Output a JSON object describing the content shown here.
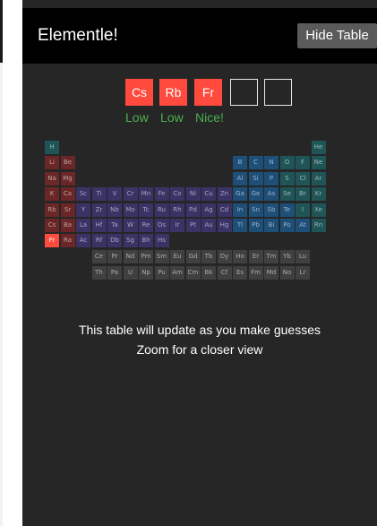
{
  "app": {
    "title": "Elementle!",
    "hide_table_label": "Hide Table"
  },
  "guesses": [
    {
      "symbol": "Cs",
      "feedback": "Low"
    },
    {
      "symbol": "Rb",
      "feedback": "Low"
    },
    {
      "symbol": "Fr",
      "feedback": "Nice!"
    },
    {
      "symbol": "",
      "feedback": ""
    },
    {
      "symbol": "",
      "feedback": ""
    }
  ],
  "message": {
    "line1": "This table will update as you make guesses",
    "line2": "Zoom for a closer view"
  },
  "colors": {
    "background": "#262626",
    "topbar": "#000000",
    "guess_fill": "#ff4a3d",
    "feedback": "#4caf50",
    "metals_alkali": "#6b2727",
    "transition": "#3b3266",
    "p_block": "#1e4f79",
    "teal": "#1f5557",
    "lanthanide": "#404040",
    "highlight": "#ff4a3d"
  },
  "table": {
    "rows": [
      [
        "H",
        "",
        "",
        "",
        "",
        "",
        "",
        "",
        "",
        "",
        "",
        "",
        "",
        "",
        "",
        "",
        "",
        "He"
      ],
      [
        "Li",
        "Be",
        "",
        "",
        "",
        "",
        "",
        "",
        "",
        "",
        "",
        "",
        "B",
        "C",
        "N",
        "O",
        "F",
        "Ne"
      ],
      [
        "Na",
        "Mg",
        "",
        "",
        "",
        "",
        "",
        "",
        "",
        "",
        "",
        "",
        "Al",
        "Si",
        "P",
        "S",
        "Cl",
        "Ar"
      ],
      [
        "K",
        "Ca",
        "Sc",
        "Ti",
        "V",
        "Cr",
        "Mn",
        "Fe",
        "Co",
        "Ni",
        "Cu",
        "Zn",
        "Ga",
        "Ge",
        "As",
        "Se",
        "Br",
        "Kr"
      ],
      [
        "Rb",
        "Sr",
        "Y",
        "Zr",
        "Nb",
        "Mo",
        "Tc",
        "Ru",
        "Rh",
        "Pd",
        "Ag",
        "Cd",
        "In",
        "Sn",
        "Sb",
        "Te",
        "I",
        "Xe"
      ],
      [
        "Cs",
        "Ba",
        "La",
        "Hf",
        "Ta",
        "W",
        "Re",
        "Os",
        "Ir",
        "Pt",
        "Au",
        "Hg",
        "Tl",
        "Pb",
        "Bi",
        "Po",
        "At",
        "Rn"
      ],
      [
        "Fr",
        "Ra",
        "Ac",
        "Rf",
        "Db",
        "Sg",
        "Bh",
        "Hs",
        "",
        "",
        "",
        "",
        "",
        "",
        "",
        "",
        "",
        ""
      ]
    ],
    "lanthanides": [
      "Ce",
      "Pr",
      "Nd",
      "Pm",
      "Sm",
      "Eu",
      "Gd",
      "Tb",
      "Dy",
      "Ho",
      "Er",
      "Tm",
      "Yb",
      "Lu"
    ],
    "actinides": [
      "Th",
      "Pa",
      "U",
      "Np",
      "Pu",
      "Am",
      "Cm",
      "Bk",
      "Cf",
      "Es",
      "Fm",
      "Md",
      "No",
      "Lr"
    ],
    "highlighted": "Fr"
  }
}
